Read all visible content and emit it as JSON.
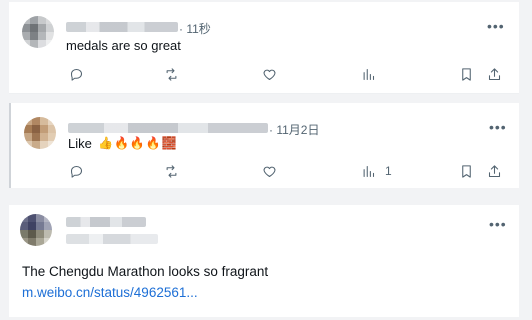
{
  "posts": [
    {
      "time": "· 11秒",
      "text": "medals are so great",
      "actions": {
        "views": ""
      }
    },
    {
      "time": "· 11月2日",
      "text": "Like",
      "emojis": [
        "👍",
        "🔥",
        "🔥",
        "🔥",
        "🧱"
      ],
      "actions": {
        "views": "1"
      }
    },
    {
      "text": "The Chengdu Marathon looks so fragrant",
      "link": "m.weibo.cn/status/4962561..."
    }
  ],
  "more_label": "•••",
  "colors": {
    "link": "#1d6fd6",
    "muted": "#536471",
    "text": "#0f1419"
  }
}
